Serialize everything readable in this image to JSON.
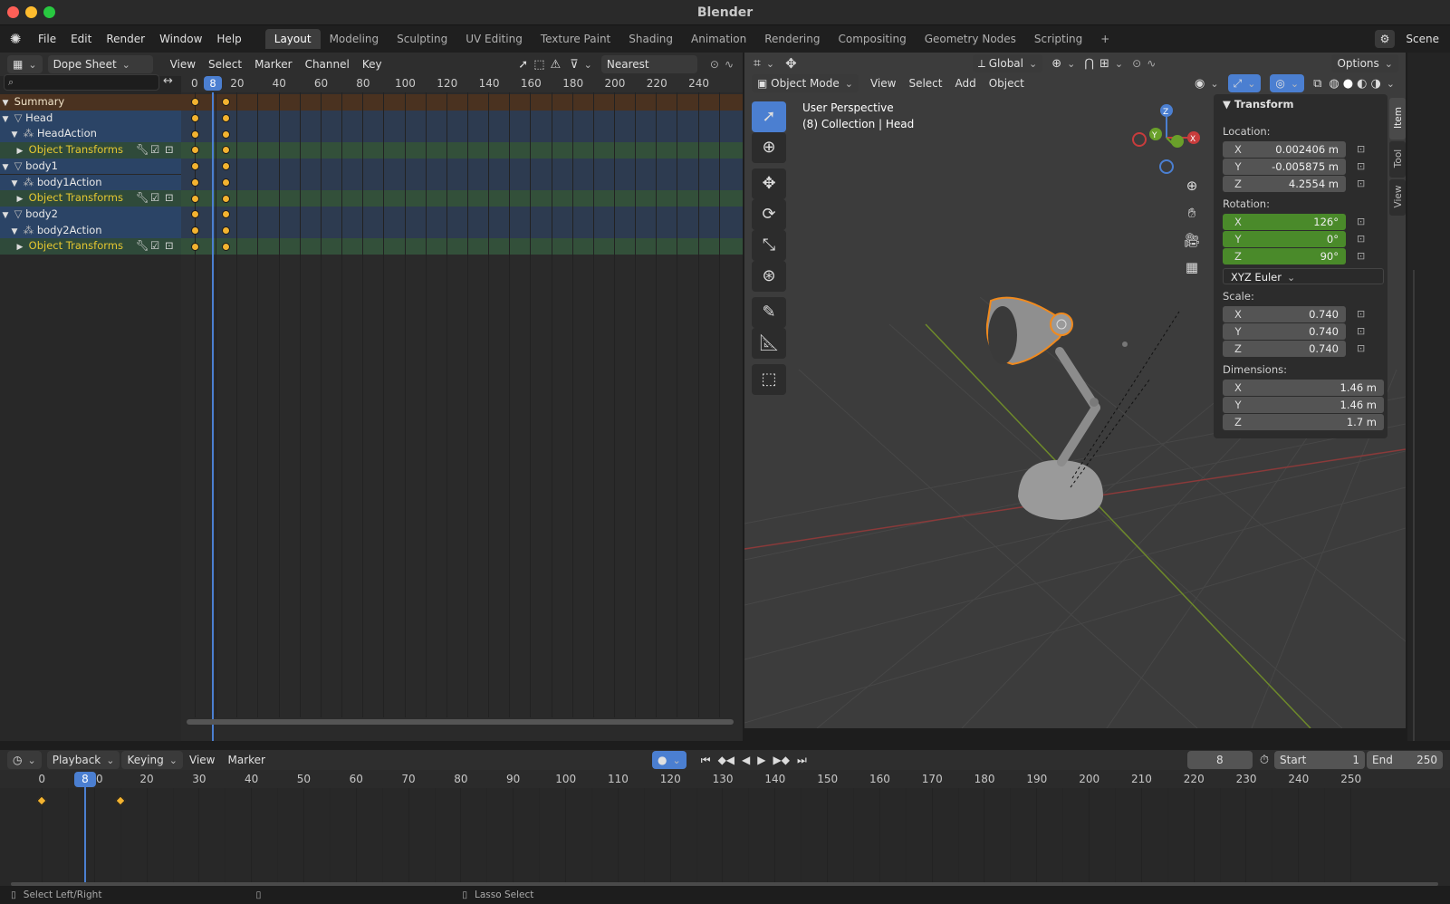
{
  "window": {
    "title": "Blender"
  },
  "menubar": {
    "menus": [
      "File",
      "Edit",
      "Render",
      "Window",
      "Help"
    ],
    "workspaces": [
      "Layout",
      "Modeling",
      "Sculpting",
      "UV Editing",
      "Texture Paint",
      "Shading",
      "Animation",
      "Rendering",
      "Compositing",
      "Geometry Nodes",
      "Scripting"
    ],
    "active_workspace": "Layout",
    "add_workspace": "+",
    "scene": "Scene"
  },
  "dopesheet": {
    "mode": "Dope Sheet",
    "menus": [
      "View",
      "Select",
      "Marker",
      "Channel",
      "Key"
    ],
    "snapping": "Nearest Frame",
    "current_frame": "8",
    "ruler": [
      "0",
      "20",
      "40",
      "60",
      "80",
      "100",
      "120",
      "140",
      "160",
      "180",
      "200",
      "220",
      "240"
    ],
    "channels": [
      {
        "label": "Summary",
        "kind": "summary"
      },
      {
        "label": "Head",
        "kind": "object"
      },
      {
        "label": "HeadAction",
        "kind": "action"
      },
      {
        "label": "Object Transforms",
        "kind": "group"
      },
      {
        "label": "body1",
        "kind": "object"
      },
      {
        "label": "body1Action",
        "kind": "action"
      },
      {
        "label": "Object Transforms",
        "kind": "group"
      },
      {
        "label": "body2",
        "kind": "object"
      },
      {
        "label": "body2Action",
        "kind": "action"
      },
      {
        "label": "Object Transforms",
        "kind": "group"
      }
    ],
    "keyframes_at": [
      0,
      15
    ]
  },
  "viewport": {
    "mode": "Object Mode",
    "menus": [
      "View",
      "Select",
      "Add",
      "Object"
    ],
    "orientation": "Global",
    "options": "Options",
    "perspective": "User Perspective",
    "collection": "(8) Collection | Head",
    "side_tabs": [
      "Item",
      "Tool",
      "View"
    ]
  },
  "transform": {
    "title": "Transform",
    "location_label": "Location:",
    "location": [
      {
        "axis": "X",
        "value": "0.002406 m"
      },
      {
        "axis": "Y",
        "value": "-0.005875 m"
      },
      {
        "axis": "Z",
        "value": "4.2554 m"
      }
    ],
    "rotation_label": "Rotation:",
    "rotation": [
      {
        "axis": "X",
        "value": "126°"
      },
      {
        "axis": "Y",
        "value": "0°"
      },
      {
        "axis": "Z",
        "value": "90°"
      }
    ],
    "rotation_mode": "XYZ Euler",
    "scale_label": "Scale:",
    "scale": [
      {
        "axis": "X",
        "value": "0.740"
      },
      {
        "axis": "Y",
        "value": "0.740"
      },
      {
        "axis": "Z",
        "value": "0.740"
      }
    ],
    "dimensions_label": "Dimensions:",
    "dimensions": [
      {
        "axis": "X",
        "value": "1.46 m"
      },
      {
        "axis": "Y",
        "value": "1.46 m"
      },
      {
        "axis": "Z",
        "value": "1.7 m"
      }
    ]
  },
  "timeline": {
    "menus": [
      "Playback",
      "Keying",
      "View",
      "Marker"
    ],
    "current_frame": "8",
    "start_label": "Start",
    "start": "1",
    "end_label": "End",
    "end": "250",
    "ruler": [
      "0",
      "20",
      "30",
      "40",
      "50",
      "60",
      "70",
      "80",
      "90",
      "100",
      "110",
      "120",
      "130",
      "140",
      "150",
      "160",
      "170",
      "180",
      "190",
      "200",
      "210",
      "220",
      "230",
      "240",
      "250"
    ],
    "ruler_partial": "0",
    "keyframes_at": [
      0,
      15
    ]
  },
  "statusbar": {
    "left": "Select Left/Right",
    "middle": "Lasso Select"
  }
}
